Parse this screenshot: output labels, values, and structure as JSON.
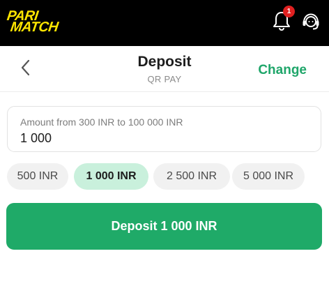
{
  "brand": {
    "logo_line1": "PARI",
    "logo_line2": "MATCH",
    "accent_color": "#ffe500"
  },
  "topbar": {
    "notifications_icon": "bell-icon",
    "notification_count": "1",
    "support_icon": "headset-icon"
  },
  "header": {
    "back_icon": "chevron-left-icon",
    "title": "Deposit",
    "subtitle": "QR PAY",
    "change_label": "Change"
  },
  "amount": {
    "label": "Amount from 300 INR to 100 000 INR",
    "value": "1 000"
  },
  "quick_amounts": [
    {
      "label": "500 INR",
      "selected": false
    },
    {
      "label": "1 000 INR",
      "selected": true
    },
    {
      "label": "2 500 INR",
      "selected": false
    },
    {
      "label": "5 000 INR",
      "selected": false
    }
  ],
  "deposit_button": {
    "label": "Deposit 1 000 INR",
    "color": "#1faa68"
  }
}
